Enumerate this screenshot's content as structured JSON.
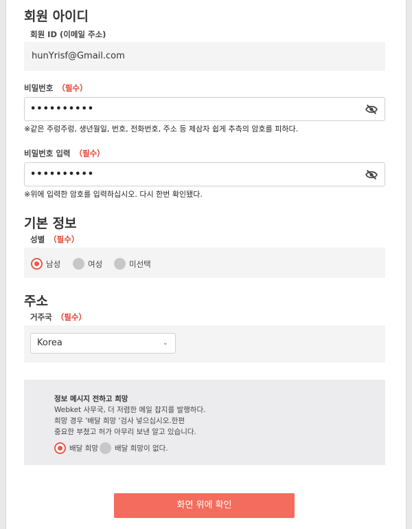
{
  "member_id_section": {
    "title": "회원 아이디",
    "field_label": "회원 ID (이메일 주소)",
    "value": "hunYrisf@Gmail.com"
  },
  "password": {
    "label": "비밀번호",
    "required": "（필수）",
    "value": "••••••••••",
    "hint": "※같은 주렁주렁, 생년월일, 번호, 전화번호, 주소 등 제삼자 쉽게 추측의 암호를 피하다."
  },
  "password_confirm": {
    "label": "비밀번호 입력",
    "required": "（필수）",
    "value": "••••••••••",
    "hint": "※위에 입력한 암호를 입력하십시오. 다시 한번 확인됐다."
  },
  "basic_info": {
    "title": "기본 정보",
    "gender_label": "성별",
    "required": "（필수）",
    "options": [
      "남성",
      "여성",
      "미선택"
    ],
    "selected": "남성"
  },
  "address": {
    "title": "주소",
    "country_label": "거주국",
    "required": "（필수）",
    "country_value": "Korea"
  },
  "newsletter": {
    "title": "정보 메시지 전하고 희망",
    "lines": [
      "Webket 사무국, 더 저렴한 메일 잡지를 발행하다.",
      "희망 경우 '배달 희망 '검사 넣으십시오.한편",
      "중요한 부쳤고 허가 아무리 보낸 알고 있습니다."
    ],
    "options": [
      "배달 희망",
      "배달 희망이 없다."
    ],
    "selected": "배달 희망"
  },
  "submit_label": "화면 위에 확인",
  "colors": {
    "accent": "#f36c5e",
    "required": "#e0402f",
    "radio_selected": "#e8584a"
  }
}
